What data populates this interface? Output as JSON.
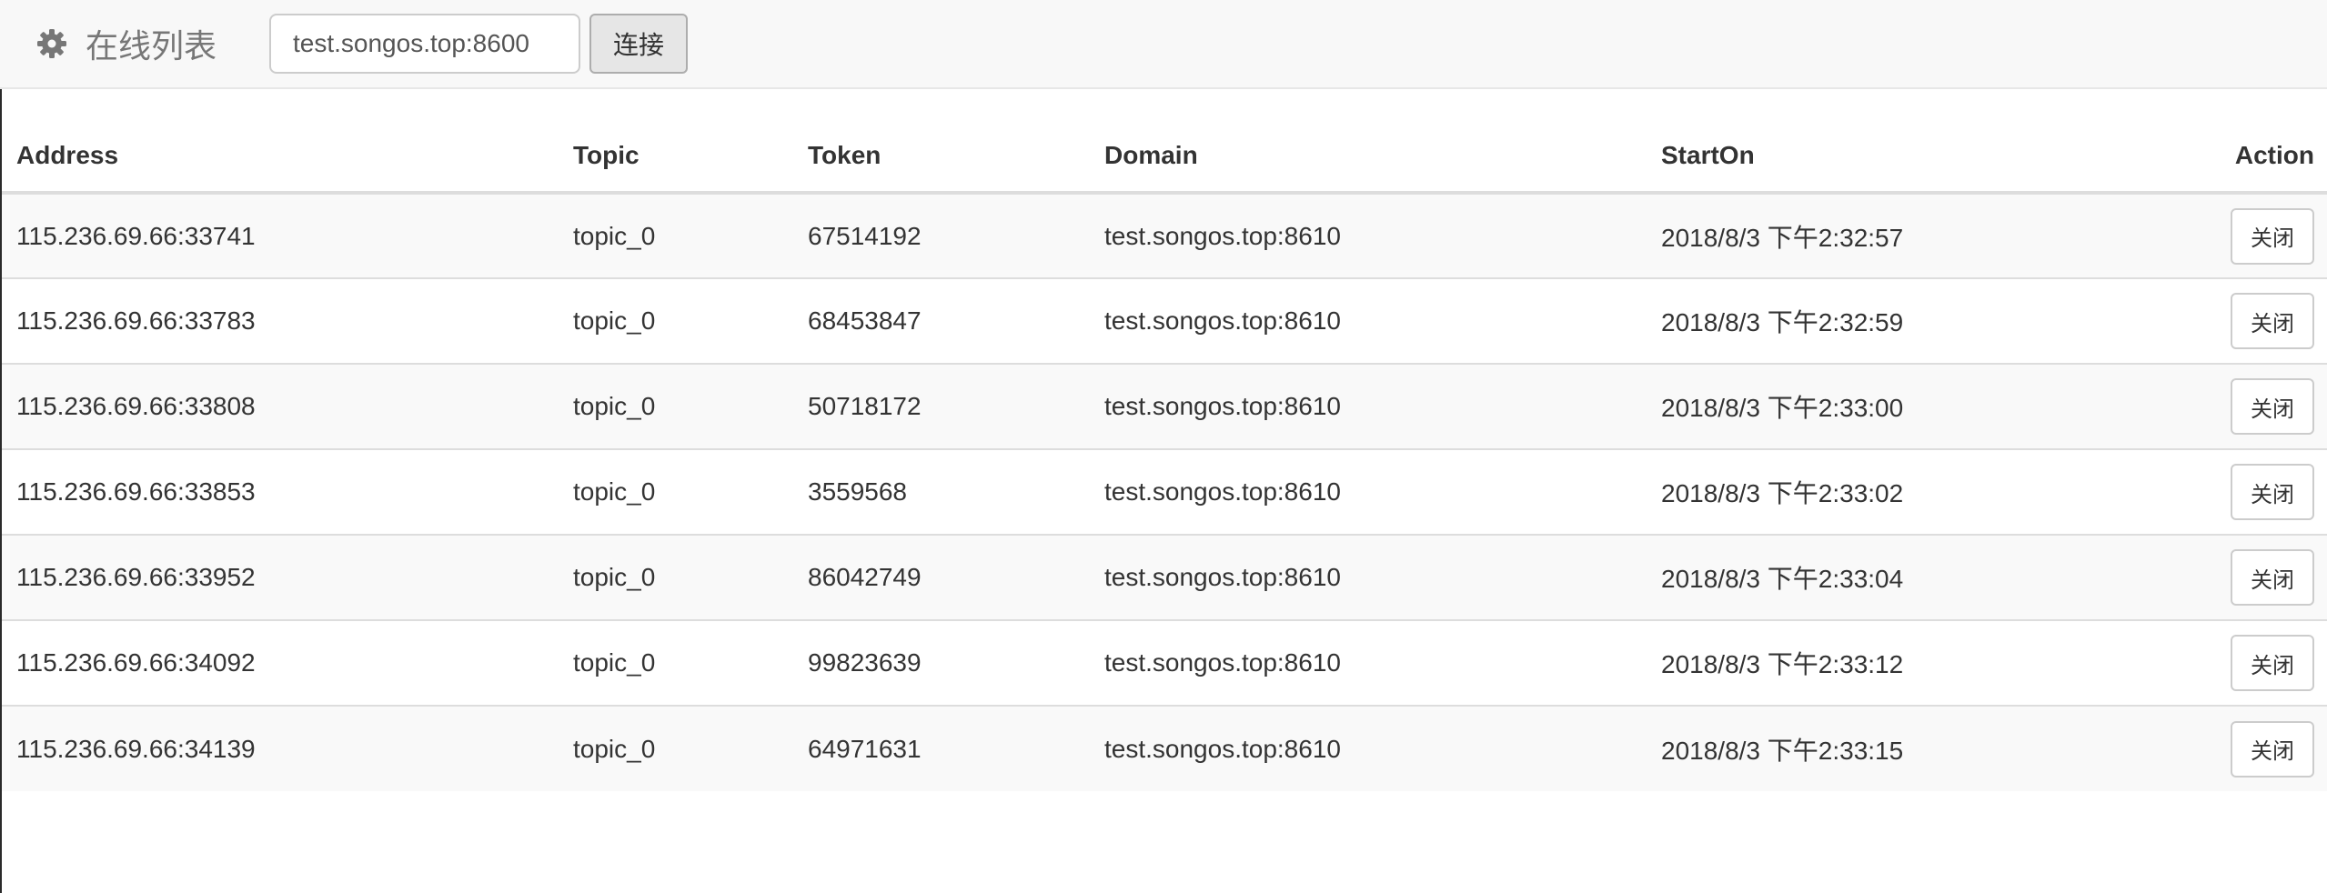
{
  "navbar": {
    "brand_icon": "gear-icon",
    "brand_title": "在线列表",
    "address_value": "test.songos.top:8600",
    "connect_label": "连接"
  },
  "table": {
    "headers": [
      "Address",
      "Topic",
      "Token",
      "Domain",
      "StartOn",
      "Action"
    ],
    "close_label": "关闭",
    "rows": [
      {
        "address": "115.236.69.66:33741",
        "topic": "topic_0",
        "token": "67514192",
        "domain": "test.songos.top:8610",
        "start_on": "2018/8/3 下午2:32:57"
      },
      {
        "address": "115.236.69.66:33783",
        "topic": "topic_0",
        "token": "68453847",
        "domain": "test.songos.top:8610",
        "start_on": "2018/8/3 下午2:32:59"
      },
      {
        "address": "115.236.69.66:33808",
        "topic": "topic_0",
        "token": "50718172",
        "domain": "test.songos.top:8610",
        "start_on": "2018/8/3 下午2:33:00"
      },
      {
        "address": "115.236.69.66:33853",
        "topic": "topic_0",
        "token": "3559568",
        "domain": "test.songos.top:8610",
        "start_on": "2018/8/3 下午2:33:02"
      },
      {
        "address": "115.236.69.66:33952",
        "topic": "topic_0",
        "token": "86042749",
        "domain": "test.songos.top:8610",
        "start_on": "2018/8/3 下午2:33:04"
      },
      {
        "address": "115.236.69.66:34092",
        "topic": "topic_0",
        "token": "99823639",
        "domain": "test.songos.top:8610",
        "start_on": "2018/8/3 下午2:33:12"
      },
      {
        "address": "115.236.69.66:34139",
        "topic": "topic_0",
        "token": "64971631",
        "domain": "test.songos.top:8610",
        "start_on": "2018/8/3 下午2:33:15"
      }
    ]
  }
}
